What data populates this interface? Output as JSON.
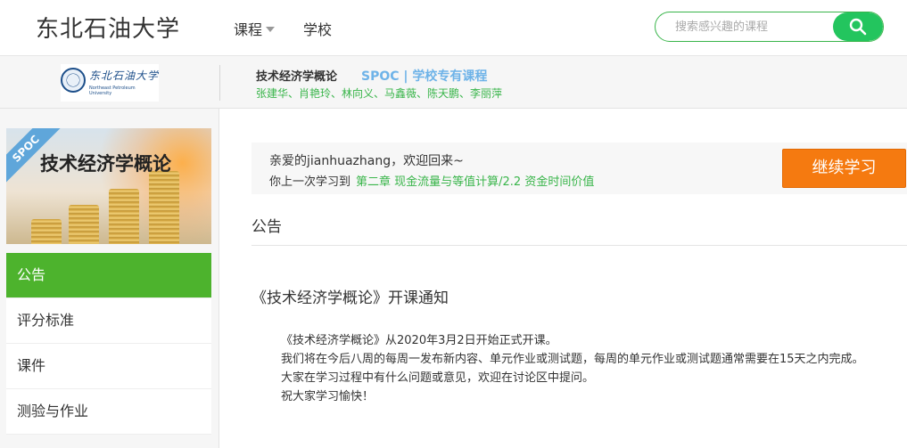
{
  "nav": {
    "brand": "东北石油大学",
    "course_link": "课程",
    "school_link": "学校",
    "search_placeholder": "搜索感兴趣的课程"
  },
  "course_header": {
    "logo_cn": "东北石油大学",
    "logo_en": "Northeast Petroleum University",
    "title": "技术经济学概论",
    "type": "SPOC | 学校专有课程",
    "teachers": "张建华、肖艳玲、林向义、马鑫薇、陈天鹏、李丽萍"
  },
  "sidebar": {
    "cover_badge": "SPOC",
    "cover_title": "技术经济学概论",
    "items": [
      {
        "label": "公告",
        "active": true
      },
      {
        "label": "评分标准",
        "active": false
      },
      {
        "label": "课件",
        "active": false
      },
      {
        "label": "测验与作业",
        "active": false
      }
    ]
  },
  "welcome": {
    "greeting": "亲爱的jianhuazhang，欢迎回来~",
    "last_prefix": "你上一次学习到",
    "last_chapter": "第二章 现金流量与等值计算/2.2 资金时间价值",
    "continue_label": "继续学习"
  },
  "main": {
    "section_title": "公告",
    "notice_title": "《技术经济学概论》开课通知",
    "notice_lines": [
      "《技术经济学概论》从2020年3月2日开始正式开课。",
      "我们将在今后八周的每周一发布新内容、单元作业或测试题，每周的单元作业或测试题通常需要在15天之内完成。",
      "大家在学习过程中有什么问题或意见，欢迎在讨论区中提问。",
      "祝大家学习愉快！"
    ]
  },
  "colors": {
    "accent_green": "#4db32d",
    "search_green": "#23c55e",
    "continue_orange": "#f57a10",
    "spoc_blue": "#6eb3e8"
  }
}
